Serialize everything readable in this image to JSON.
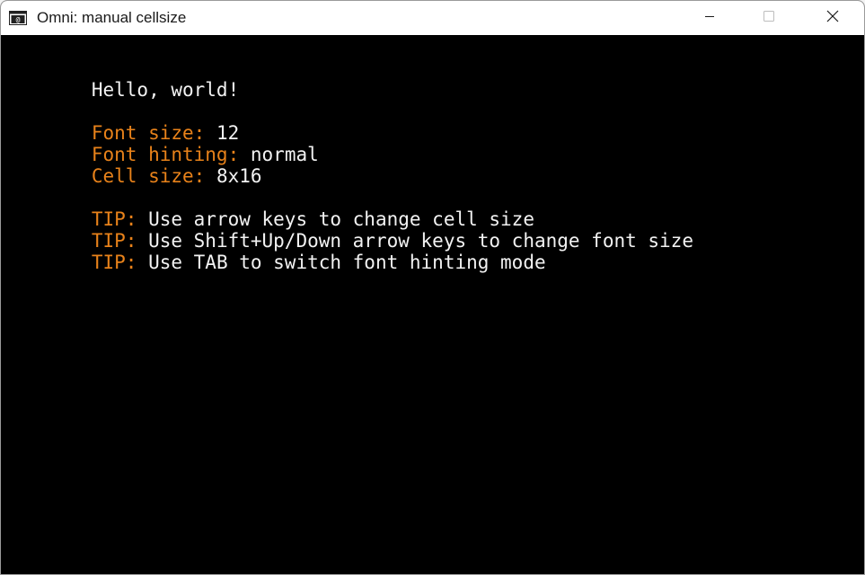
{
  "window": {
    "title": "Omni: manual cellsize",
    "icon": "console-app-icon"
  },
  "colors": {
    "label": "#e8821a",
    "text": "#f2f2f2",
    "background": "#000000"
  },
  "terminal": {
    "greeting": "Hello, world!",
    "font_size": {
      "label": "Font size:",
      "value": "12"
    },
    "font_hinting": {
      "label": "Font hinting:",
      "value": "normal"
    },
    "cell_size": {
      "label": "Cell size:",
      "value": "8x16"
    },
    "tips": [
      {
        "label": "TIP:",
        "text": "Use arrow keys to change cell size"
      },
      {
        "label": "TIP:",
        "text": "Use Shift+Up/Down arrow keys to change font size"
      },
      {
        "label": "TIP:",
        "text": "Use TAB to switch font hinting mode"
      }
    ]
  }
}
